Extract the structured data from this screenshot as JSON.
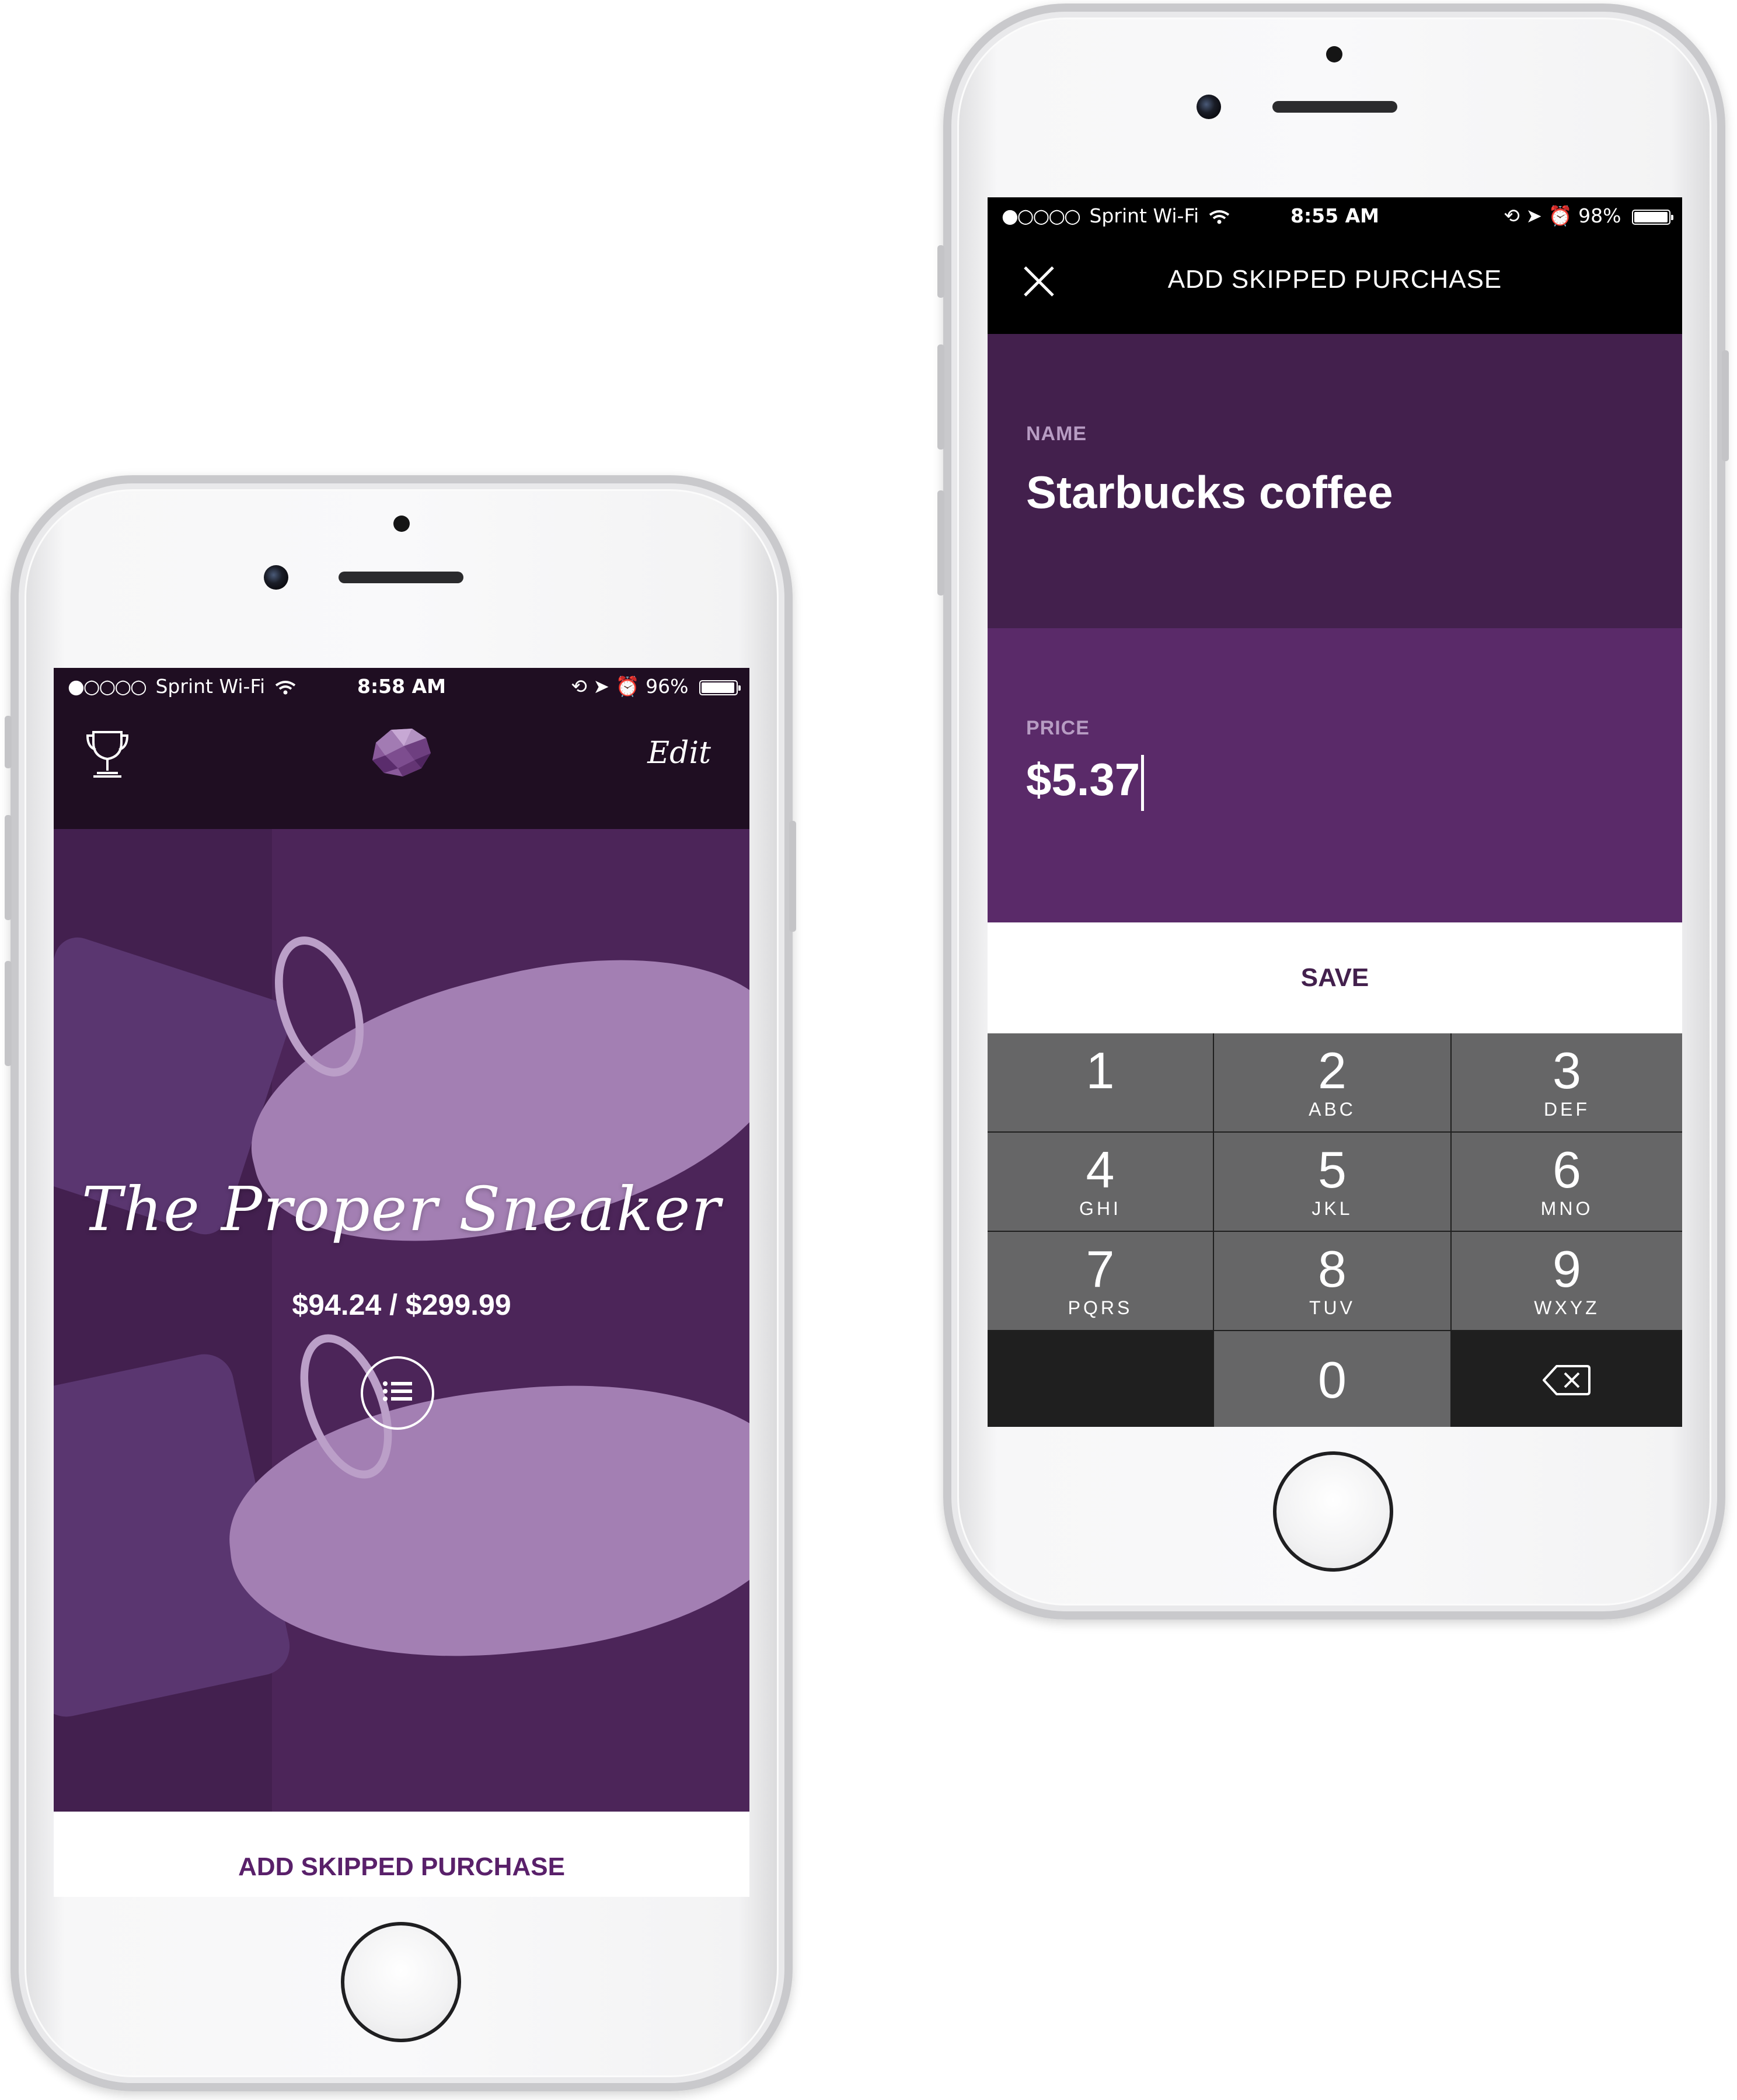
{
  "left_phone": {
    "status": {
      "carrier": "Sprint Wi-Fi",
      "time": "8:58 AM",
      "battery": "96%",
      "battery_level": 0.96
    },
    "nav": {
      "left_icon": "trophy-icon",
      "center_icon": "piggy-bank-logo",
      "edit_label": "Edit"
    },
    "goal": {
      "title": "The Proper Sneaker",
      "progress": "$94.24 / $299.99",
      "saved": 94.24,
      "target": 299.99
    },
    "list_icon": "list-icon",
    "bottom_button": "ADD SKIPPED PURCHASE"
  },
  "right_phone": {
    "status": {
      "carrier": "Sprint Wi-Fi",
      "time": "8:55 AM",
      "battery": "98%",
      "battery_level": 0.98
    },
    "nav": {
      "close_icon": "close-icon",
      "title": "ADD SKIPPED PURCHASE"
    },
    "name_field": {
      "label": "NAME",
      "value": "Starbucks coffee"
    },
    "price_field": {
      "label": "PRICE",
      "value": "$5.37"
    },
    "save_button": "SAVE",
    "keypad": [
      {
        "digit": "1",
        "letters": ""
      },
      {
        "digit": "2",
        "letters": "ABC"
      },
      {
        "digit": "3",
        "letters": "DEF"
      },
      {
        "digit": "4",
        "letters": "GHI"
      },
      {
        "digit": "5",
        "letters": "JKL"
      },
      {
        "digit": "6",
        "letters": "MNO"
      },
      {
        "digit": "7",
        "letters": "PQRS"
      },
      {
        "digit": "8",
        "letters": "TUV"
      },
      {
        "digit": "9",
        "letters": "WXYZ"
      },
      {
        "digit": "0",
        "letters": ""
      }
    ],
    "delete_icon": "backspace-icon"
  },
  "colors": {
    "brand_purple": "#59206a",
    "dark_plum": "#43204d",
    "price_purple": "#5a2a69",
    "nav_dark": "#1f0e22",
    "keypad_key": "#666667"
  }
}
